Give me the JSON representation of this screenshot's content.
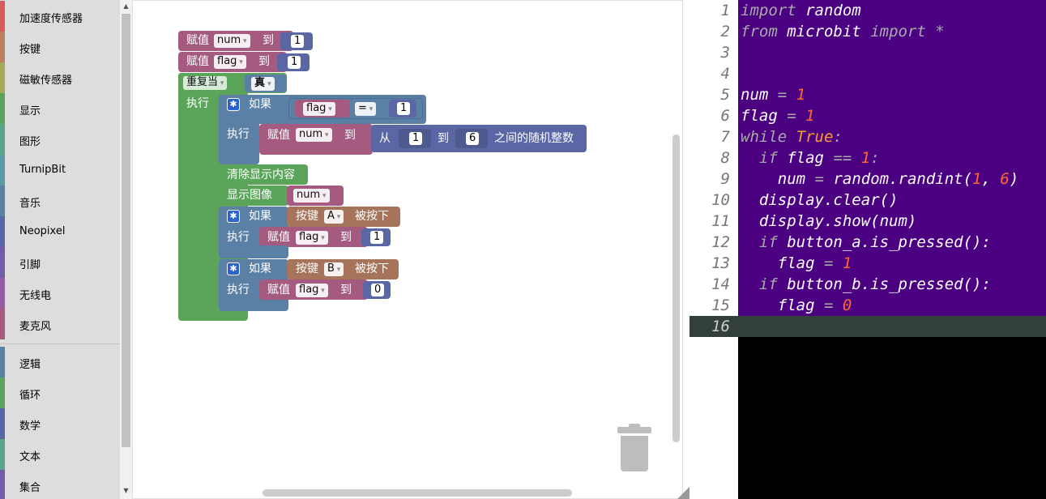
{
  "toolbox": {
    "categories": [
      {
        "label": "加速度传感器",
        "color": "#d65c5c"
      },
      {
        "label": "按键",
        "color": "#b97f5e"
      },
      {
        "label": "磁敏传感器",
        "color": "#a7a85a"
      },
      {
        "label": "显示",
        "color": "#5ba55b"
      },
      {
        "label": "图形",
        "color": "#5ba58b"
      },
      {
        "label": "TurnipBit",
        "color": "#5b9aa5"
      },
      {
        "label": "音乐",
        "color": "#5b80a5"
      },
      {
        "label": "Neopixel",
        "color": "#5b67a5"
      },
      {
        "label": "引脚",
        "color": "#745ba5"
      },
      {
        "label": "无线电",
        "color": "#995ba5"
      },
      {
        "label": "麦克风",
        "color": "#a55b80"
      },
      {
        "label": "逻辑",
        "color": "#5b80a5"
      },
      {
        "label": "循环",
        "color": "#5ba55b"
      },
      {
        "label": "数学",
        "color": "#5b67a5"
      },
      {
        "label": "文本",
        "color": "#5ba58c"
      },
      {
        "label": "集合",
        "color": "#745ba5"
      }
    ]
  },
  "blocks": {
    "set_label": "赋值",
    "to_label": "到",
    "repeat_label": "重复当",
    "true_label": "真",
    "do_label": "执行",
    "if_label": "如果",
    "eq_label": "=",
    "from_label": "从",
    "random_label": "之间的随机整数",
    "clear_label": "清除显示内容",
    "show_label": "显示图像",
    "button_label": "按键",
    "pressed_label": "被按下",
    "var_num": "num",
    "var_flag": "flag",
    "btn_a": "A",
    "btn_b": "B",
    "v1": "1",
    "v6": "6",
    "v0": "0"
  },
  "colors": {
    "variable": "#a55b80",
    "math": "#5b67a5",
    "loop": "#5ba55b",
    "logic": "#5b80a5",
    "display": "#5ba55b",
    "button": "#a5745b",
    "code_bg": "#4b0082"
  },
  "editor": {
    "line_numbers": [
      "1",
      "2",
      "3",
      "4",
      "5",
      "6",
      "7",
      "8",
      "9",
      "10",
      "11",
      "12",
      "13",
      "14",
      "15",
      "16"
    ],
    "active_line": "16"
  }
}
